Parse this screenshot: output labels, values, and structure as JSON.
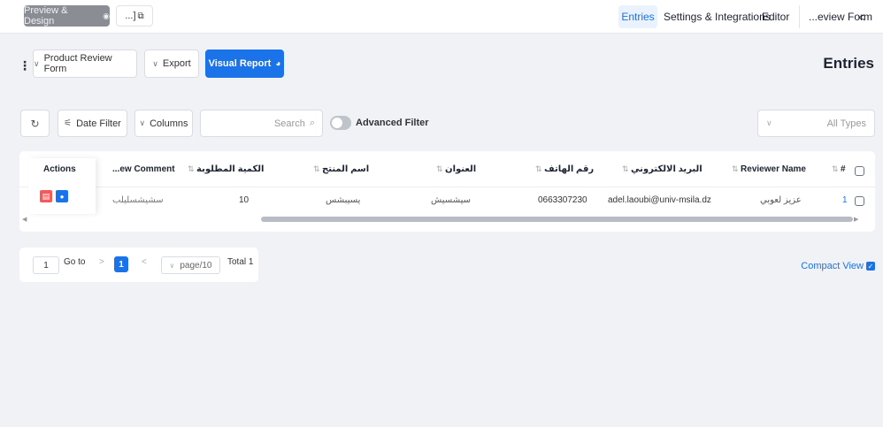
{
  "topbar": {
    "preview_label": "Preview & Design",
    "copy_label": "...]",
    "nav_entries": "Entries",
    "nav_settings": "Settings & Integrations",
    "nav_editor": "Editor",
    "nav_form": "...eview Form",
    "nav_back": "<"
  },
  "header": {
    "review_label": "Product Review Form",
    "export_label": "Export",
    "visual_label": "Visual Report",
    "page_title": "Entries"
  },
  "filters": {
    "date_label": "Date Filter",
    "columns_label": "Columns",
    "search_placeholder": "Search",
    "advanced_label": "Advanced Filter",
    "types_placeholder": "All Types"
  },
  "table": {
    "headers": {
      "id": "#",
      "reviewer": "Reviewer Name",
      "email": "البريد الالكتروني",
      "phone": "رقم الهاتف",
      "address": "العنوان",
      "product": "اسم المنتج",
      "quantity": "الكمية المطلوبة",
      "comment": "...ew Comment",
      "actions": "Actions"
    },
    "rows": [
      {
        "id": "1",
        "reviewer": "عزيز لعوبي",
        "email": "adel.laoubi@univ-msila.dz",
        "phone": "0663307230",
        "address": "سيشسيش",
        "product": "يسيبشس",
        "quantity": "10",
        "comment": "سشيشسليلب"
      }
    ]
  },
  "pagination": {
    "goto_value": "1",
    "goto_label": "Go to",
    "current_page": "1",
    "page_size": "page/10",
    "total": "Total 1",
    "next": ">",
    "prev": "<"
  },
  "compact_label": "Compact View",
  "colors": {
    "accent": "#1a73e8",
    "danger": "#f35a5a",
    "preview_bg": "#8a8d94"
  }
}
